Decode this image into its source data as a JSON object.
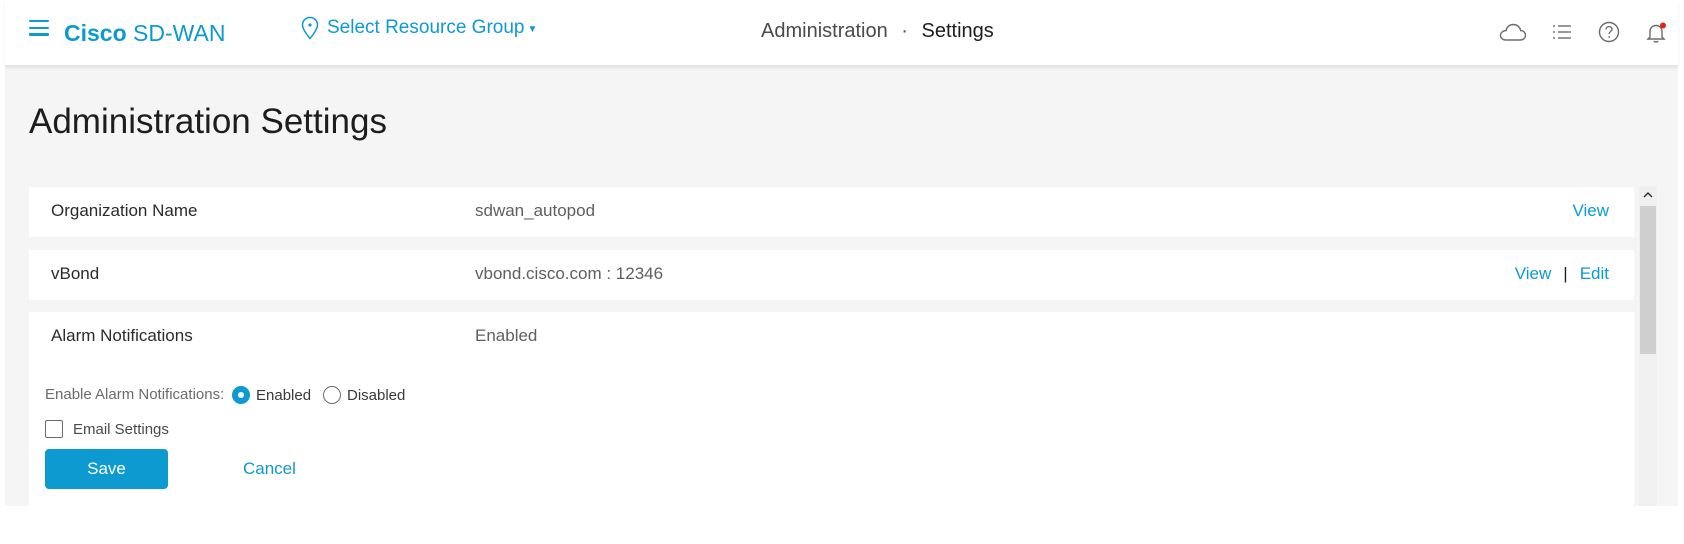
{
  "header": {
    "brand_bold": "Cisco",
    "brand_light": "SD-WAN",
    "resource_group": "Select Resource Group",
    "crumb_section": "Administration",
    "crumb_separator": "·",
    "crumb_current": "Settings",
    "icons": [
      "cloud-icon",
      "task-list-icon",
      "help-icon",
      "bell-icon"
    ]
  },
  "page": {
    "title": "Administration Settings"
  },
  "settings": {
    "organization": {
      "label": "Organization Name",
      "value": "sdwan_autopod",
      "view": "View"
    },
    "vbond": {
      "label": "vBond",
      "value": "vbond.cisco.com : 12346",
      "view": "View",
      "separator": "|",
      "edit": "Edit"
    },
    "alarm": {
      "label": "Alarm Notifications",
      "value": "Enabled",
      "enable_label": "Enable Alarm Notifications:",
      "option_enabled": "Enabled",
      "option_disabled": "Disabled",
      "selected": "Enabled",
      "email_settings": "Email Settings",
      "email_checked": false,
      "save": "Save",
      "cancel": "Cancel"
    }
  },
  "colors": {
    "accent": "#0d9ad0",
    "notification_dot": "#e2231a",
    "content_bg": "#f5f5f5"
  }
}
